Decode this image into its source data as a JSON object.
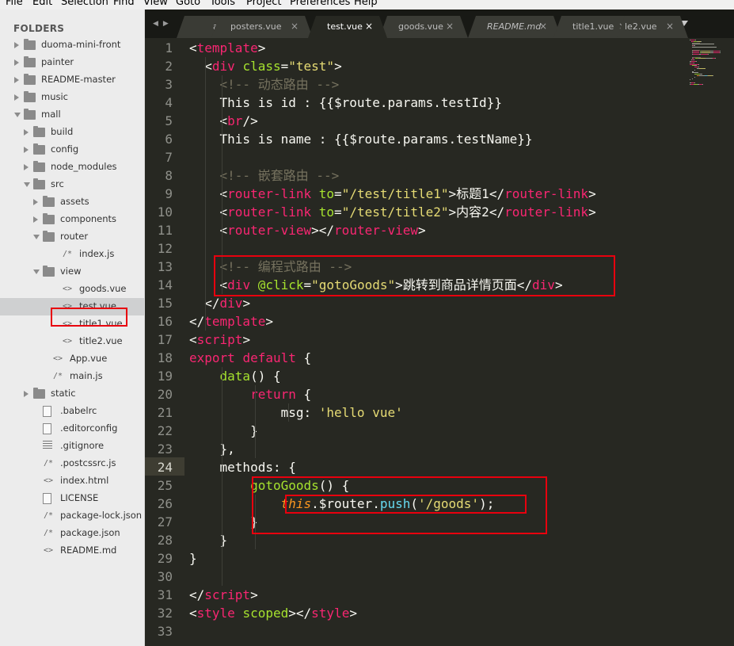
{
  "menu": [
    "File",
    "Edit",
    "Selection",
    "Find",
    "View",
    "Goto",
    "Tools",
    "Project",
    "Preferences",
    "Help"
  ],
  "sidebar": {
    "title": "FOLDERS",
    "items": [
      {
        "label": "duoma-mini-front",
        "type": "folder",
        "depth": 0,
        "expanded": false
      },
      {
        "label": "painter",
        "type": "folder",
        "depth": 0,
        "expanded": false
      },
      {
        "label": "README-master",
        "type": "folder",
        "depth": 0,
        "expanded": false
      },
      {
        "label": "music",
        "type": "folder",
        "depth": 0,
        "expanded": false
      },
      {
        "label": "mall",
        "type": "folder",
        "depth": 0,
        "expanded": true
      },
      {
        "label": "build",
        "type": "folder",
        "depth": 1,
        "expanded": false
      },
      {
        "label": "config",
        "type": "folder",
        "depth": 1,
        "expanded": false
      },
      {
        "label": "node_modules",
        "type": "folder",
        "depth": 1,
        "expanded": false
      },
      {
        "label": "src",
        "type": "folder",
        "depth": 1,
        "expanded": true
      },
      {
        "label": "assets",
        "type": "folder",
        "depth": 2,
        "expanded": false
      },
      {
        "label": "components",
        "type": "folder",
        "depth": 2,
        "expanded": false
      },
      {
        "label": "router",
        "type": "folder",
        "depth": 2,
        "expanded": true
      },
      {
        "label": "index.js",
        "type": "file",
        "icon": "/*",
        "depth": 3
      },
      {
        "label": "view",
        "type": "folder",
        "depth": 2,
        "expanded": true
      },
      {
        "label": "goods.vue",
        "type": "file",
        "icon": "<>",
        "depth": 3
      },
      {
        "label": "test.vue",
        "type": "file",
        "icon": "<>",
        "depth": 3,
        "selected": true
      },
      {
        "label": "title1.vue",
        "type": "file",
        "icon": "<>",
        "depth": 3
      },
      {
        "label": "title2.vue",
        "type": "file",
        "icon": "<>",
        "depth": 3
      },
      {
        "label": "App.vue",
        "type": "file",
        "icon": "<>",
        "depth": 2
      },
      {
        "label": "main.js",
        "type": "file",
        "icon": "/*",
        "depth": 2
      },
      {
        "label": "static",
        "type": "folder",
        "depth": 1,
        "expanded": false
      },
      {
        "label": ".babelrc",
        "type": "file",
        "icon": "doc",
        "depth": 1
      },
      {
        "label": ".editorconfig",
        "type": "file",
        "icon": "doc",
        "depth": 1
      },
      {
        "label": ".gitignore",
        "type": "file",
        "icon": "lines",
        "depth": 1
      },
      {
        "label": ".postcssrc.js",
        "type": "file",
        "icon": "/*",
        "depth": 1
      },
      {
        "label": "index.html",
        "type": "file",
        "icon": "<>",
        "depth": 1
      },
      {
        "label": "LICENSE",
        "type": "file",
        "icon": "doc",
        "depth": 1
      },
      {
        "label": "package-lock.json",
        "type": "file",
        "icon": "/*",
        "depth": 1
      },
      {
        "label": "package.json",
        "type": "file",
        "icon": "/*",
        "depth": 1
      },
      {
        "label": "README.md",
        "type": "file",
        "icon": "<>",
        "depth": 1
      }
    ]
  },
  "tabs": [
    {
      "label": "a",
      "close": ""
    },
    {
      "label": "posters.vue",
      "close": "×"
    },
    {
      "label": "test.vue",
      "close": "×",
      "active": true
    },
    {
      "label": "goods.vue",
      "close": "×"
    },
    {
      "label": "README.md",
      "close": "×",
      "italic": true
    },
    {
      "label": "title1.vue",
      "close": "×"
    },
    {
      "label": "le2.vue",
      "close": "×"
    }
  ],
  "tab_nav": "◀▶",
  "editor": {
    "current_line": 24,
    "lines": [
      [
        [
          "t-txt",
          "<"
        ],
        [
          "t-tag",
          "template"
        ],
        [
          "t-txt",
          ">"
        ]
      ],
      [
        [
          "t-txt",
          "  <"
        ],
        [
          "t-tag",
          "div"
        ],
        [
          "t-txt",
          " "
        ],
        [
          "t-attr",
          "class"
        ],
        [
          "t-txt",
          "="
        ],
        [
          "t-str",
          "\"test\""
        ],
        [
          "t-txt",
          ">"
        ]
      ],
      [
        [
          "t-com",
          "    <!-- 动态路由 -->"
        ]
      ],
      [
        [
          "t-txt",
          "    This is id : {{$route.params.testId}}"
        ]
      ],
      [
        [
          "t-txt",
          "    <"
        ],
        [
          "t-tag",
          "br"
        ],
        [
          "t-txt",
          "/>"
        ]
      ],
      [
        [
          "t-txt",
          "    This is name : {{$route.params.testName}}"
        ]
      ],
      [],
      [
        [
          "t-com",
          "    <!-- 嵌套路由 -->"
        ]
      ],
      [
        [
          "t-txt",
          "    <"
        ],
        [
          "t-tag",
          "router-link"
        ],
        [
          "t-txt",
          " "
        ],
        [
          "t-attr",
          "to"
        ],
        [
          "t-txt",
          "="
        ],
        [
          "t-str",
          "\"/test/title1\""
        ],
        [
          "t-txt",
          ">标题1</"
        ],
        [
          "t-tag",
          "router-link"
        ],
        [
          "t-txt",
          ">"
        ]
      ],
      [
        [
          "t-txt",
          "    <"
        ],
        [
          "t-tag",
          "router-link"
        ],
        [
          "t-txt",
          " "
        ],
        [
          "t-attr",
          "to"
        ],
        [
          "t-txt",
          "="
        ],
        [
          "t-str",
          "\"/test/title2\""
        ],
        [
          "t-txt",
          ">内容2</"
        ],
        [
          "t-tag",
          "router-link"
        ],
        [
          "t-txt",
          ">"
        ]
      ],
      [
        [
          "t-txt",
          "    <"
        ],
        [
          "t-tag",
          "router-view"
        ],
        [
          "t-txt",
          "></"
        ],
        [
          "t-tag",
          "router-view"
        ],
        [
          "t-txt",
          ">"
        ]
      ],
      [],
      [
        [
          "t-com",
          "    <!-- 编程式路由 -->"
        ]
      ],
      [
        [
          "t-txt",
          "    <"
        ],
        [
          "t-tag",
          "div"
        ],
        [
          "t-txt",
          " "
        ],
        [
          "t-attr",
          "@click"
        ],
        [
          "t-txt",
          "="
        ],
        [
          "t-str",
          "\"gotoGoods\""
        ],
        [
          "t-txt",
          ">跳转到商品详情页面</"
        ],
        [
          "t-tag",
          "div"
        ],
        [
          "t-txt",
          ">"
        ]
      ],
      [
        [
          "t-txt",
          "  </"
        ],
        [
          "t-tag",
          "div"
        ],
        [
          "t-txt",
          ">"
        ]
      ],
      [
        [
          "t-txt",
          "</"
        ],
        [
          "t-tag",
          "template"
        ],
        [
          "t-txt",
          ">"
        ]
      ],
      [
        [
          "t-txt",
          "<"
        ],
        [
          "t-tag",
          "script"
        ],
        [
          "t-txt",
          ">"
        ]
      ],
      [
        [
          "t-kw",
          "export"
        ],
        [
          "t-txt",
          " "
        ],
        [
          "t-kw",
          "default"
        ],
        [
          "t-txt",
          " {"
        ]
      ],
      [
        [
          "t-txt",
          "    "
        ],
        [
          "t-def",
          "data"
        ],
        [
          "t-txt",
          "() {"
        ]
      ],
      [
        [
          "t-txt",
          "        "
        ],
        [
          "t-kw",
          "return"
        ],
        [
          "t-txt",
          " {"
        ]
      ],
      [
        [
          "t-txt",
          "            msg: "
        ],
        [
          "t-str",
          "'hello vue'"
        ]
      ],
      [
        [
          "t-txt",
          "        }"
        ]
      ],
      [
        [
          "t-txt",
          "    },"
        ]
      ],
      [
        [
          "t-txt",
          "    methods: {"
        ]
      ],
      [
        [
          "t-txt",
          "        "
        ],
        [
          "t-def",
          "gotoGoods"
        ],
        [
          "t-txt",
          "() {"
        ]
      ],
      [
        [
          "t-txt",
          "            "
        ],
        [
          "t-this",
          "this"
        ],
        [
          "t-txt",
          ".$router."
        ],
        [
          "t-fn",
          "push"
        ],
        [
          "t-txt",
          "("
        ],
        [
          "t-str",
          "'/goods'"
        ],
        [
          "t-txt",
          ");"
        ]
      ],
      [
        [
          "t-txt",
          "        }"
        ]
      ],
      [
        [
          "t-txt",
          "    }"
        ]
      ],
      [
        [
          "t-txt",
          "}"
        ]
      ],
      [],
      [
        [
          "t-txt",
          "</"
        ],
        [
          "t-tag",
          "script"
        ],
        [
          "t-txt",
          ">"
        ]
      ],
      [
        [
          "t-txt",
          "<"
        ],
        [
          "t-tag",
          "style"
        ],
        [
          "t-txt",
          " "
        ],
        [
          "t-attr",
          "scoped"
        ],
        [
          "t-txt",
          "></"
        ],
        [
          "t-tag",
          "style"
        ],
        [
          "t-txt",
          ">"
        ]
      ],
      []
    ]
  }
}
